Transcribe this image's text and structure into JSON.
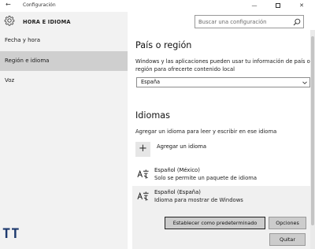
{
  "window": {
    "title": "Configuración",
    "back_icon": "back-arrow-icon",
    "controls": {
      "minimize": "—",
      "maximize": "square",
      "close": "✕"
    }
  },
  "sidebar": {
    "header_title": "HORA E IDIOMA",
    "header_icon": "gear-icon",
    "items": [
      {
        "label": "Fecha y hora",
        "selected": false
      },
      {
        "label": "Región e idioma",
        "selected": true
      },
      {
        "label": "Voz",
        "selected": false
      }
    ],
    "logo_text": "TT"
  },
  "search": {
    "placeholder": "Buscar una configuración",
    "icon": "search-icon"
  },
  "region": {
    "heading": "País o región",
    "description": "Windows y las aplicaciones pueden usar tu información de país o región para ofrecerte contenido local",
    "selected_value": "España"
  },
  "languages": {
    "heading": "Idiomas",
    "description": "Agregar un idioma para leer y escribir en ese idioma",
    "add_label": "Agregar un idioma",
    "items": [
      {
        "name": "Español (México)",
        "status": "Solo se permite un paquete de idioma",
        "expanded": false
      },
      {
        "name": "Español (España)",
        "status": "Idioma para mostrar de Windows",
        "expanded": true
      }
    ],
    "buttons": {
      "set_default": "Establecer como predeterminado",
      "options": "Opciones",
      "remove": "Quitar"
    }
  },
  "colors": {
    "sidebar_bg": "#f2f2f2",
    "selected_nav_bg": "#cfcfcf",
    "button_bg": "#cccccc",
    "logo": "#1e3a6e"
  }
}
